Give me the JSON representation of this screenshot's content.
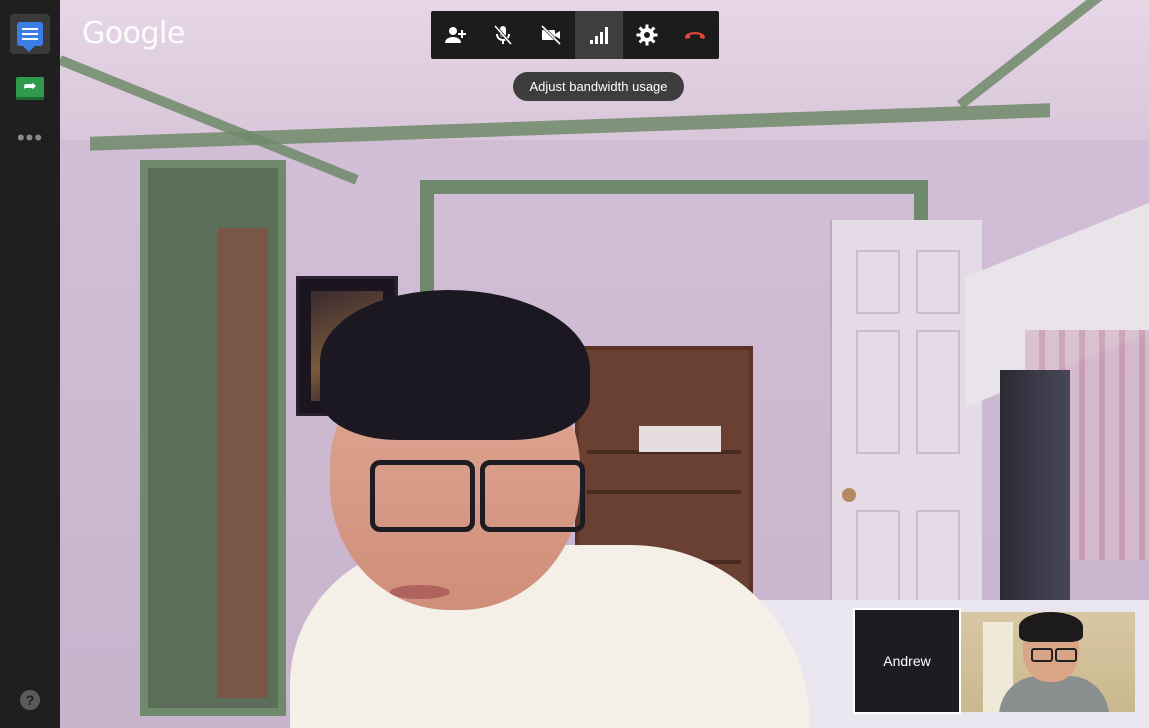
{
  "app": {
    "logo_text": "Google"
  },
  "sidebar": {
    "items": [
      {
        "name": "chat",
        "icon": "chat-icon",
        "active": true
      },
      {
        "name": "screenshare",
        "icon": "screenshare-icon",
        "active": false
      },
      {
        "name": "more",
        "icon": "more-dots-icon",
        "label": "•••"
      }
    ],
    "help": {
      "icon": "help-icon",
      "label": "?"
    }
  },
  "toolbar": {
    "buttons": [
      {
        "name": "invite-people",
        "icon": "add-person-icon"
      },
      {
        "name": "mute-mic",
        "icon": "mic-off-icon"
      },
      {
        "name": "camera-off",
        "icon": "camera-off-icon"
      },
      {
        "name": "bandwidth",
        "icon": "signal-bars-icon",
        "hovered": true
      },
      {
        "name": "settings",
        "icon": "gear-icon"
      },
      {
        "name": "end-call",
        "icon": "hang-up-icon",
        "color": "#e0443a"
      }
    ],
    "tooltip": "Adjust bandwidth usage"
  },
  "participants": {
    "self": {
      "label": "Andrew",
      "selected": true
    },
    "other": {
      "label": ""
    }
  },
  "colors": {
    "toolbar_bg": "#1c1c1c",
    "hover_bg": "#3e3e3e",
    "end_call": "#e0443a",
    "sidebar_bg": "#1f1f1f",
    "chat_accent": "#3b7ee6",
    "share_accent": "#2f9a4b"
  }
}
